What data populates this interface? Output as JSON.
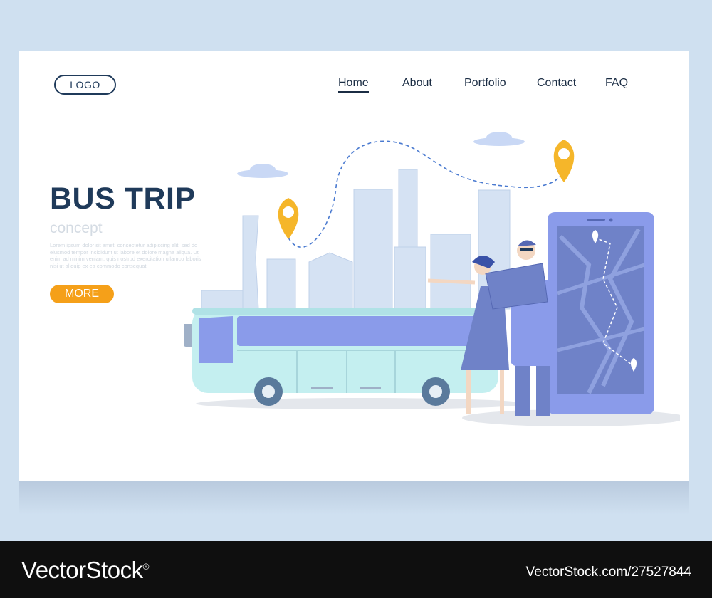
{
  "header": {
    "logo_label": "LOGO",
    "nav": [
      {
        "label": "Home",
        "active": true
      },
      {
        "label": "About",
        "active": false
      },
      {
        "label": "Portfolio",
        "active": false
      },
      {
        "label": "Contact",
        "active": false
      },
      {
        "label": "FAQ",
        "active": false
      }
    ]
  },
  "hero": {
    "title": "BUS TRIP",
    "subtitle": "concept",
    "body": "Lorem ipsum dolor sit amet, consectetur adipiscing elit, sed do eiusmod tempor incididunt ut labore et dolore magna aliqua. Ut enim ad minim veniam, quis nostrud exercitation ullamco laboris nisi ut aliquip ex ea commodo consequat.",
    "cta_label": "MORE"
  },
  "colors": {
    "page_bg": "#cfe0f0",
    "title": "#1f3a5a",
    "accent_orange": "#f5a019",
    "pin_yellow": "#f5b62a",
    "bus_body": "#c4eff0",
    "phone": "#8a9bea",
    "footer_bg": "#0f0f0f"
  },
  "footer": {
    "brand": "VectorStock",
    "trademark": "®",
    "image_id": "VectorStock.com/27527844"
  }
}
